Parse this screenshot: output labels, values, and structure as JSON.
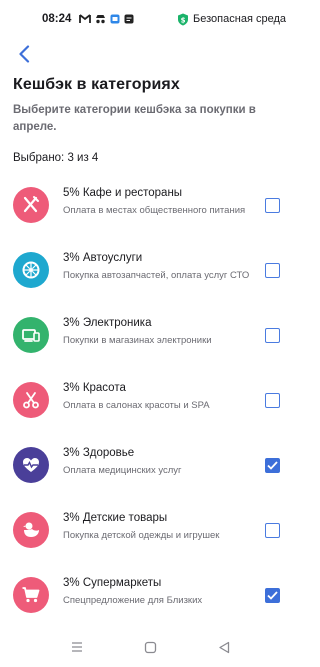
{
  "status": {
    "time": "08:24",
    "secure_label": "Безопасная среда",
    "secure_color": "#1bb36a"
  },
  "header": {
    "title": "Кешбэк в категориях",
    "subtitle": "Выберите категории кешбэка за покупки в апреле."
  },
  "selection": {
    "label": "Выбрано: 3 из 4"
  },
  "colors": {
    "accent": "#3d6fd9",
    "pink": "#ee5b79",
    "teal": "#1ea8cf",
    "green": "#33b36d",
    "indigo": "#4a3f99"
  },
  "categories": [
    {
      "icon": "fork-knife-icon",
      "color": "#ee5b79",
      "name": "5% Кафе и рестораны",
      "desc": "Оплата в местах общественного питания",
      "checked": false
    },
    {
      "icon": "car-wheel-icon",
      "color": "#1ea8cf",
      "name": "3% Автоуслуги",
      "desc": "Покупка автозапчастей, оплата услуг СТО",
      "checked": false
    },
    {
      "icon": "devices-icon",
      "color": "#33b36d",
      "name": "3% Электроника",
      "desc": "Покупки в магазинах электроники",
      "checked": false
    },
    {
      "icon": "scissors-icon",
      "color": "#ee5b79",
      "name": "3% Красота",
      "desc": "Оплата в салонах красоты и SPA",
      "checked": false
    },
    {
      "icon": "heart-pulse-icon",
      "color": "#4a3f99",
      "name": "3% Здоровье",
      "desc": "Оплата медицинских услуг",
      "checked": true
    },
    {
      "icon": "duck-toy-icon",
      "color": "#ee5b79",
      "name": "3% Детские товары",
      "desc": "Покупка детской одежды и игрушек",
      "checked": false
    },
    {
      "icon": "cart-icon",
      "color": "#ee5b79",
      "name": "3% Супермаркеты",
      "desc": "Спецпредложение для Близких",
      "checked": true
    }
  ]
}
